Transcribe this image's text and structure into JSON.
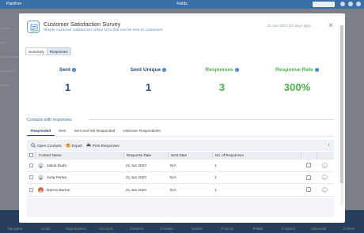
{
  "app": {
    "logo_text": "Pipeliner",
    "title": "Fields",
    "sidebar_items": [
      "Emails",
      "Files",
      "Opportunities",
      "Marketing",
      "Notes"
    ],
    "bottom_nav": [
      {
        "label": "Navigator",
        "active": false
      },
      {
        "label": "Leads",
        "active": false
      },
      {
        "label": "Opportunities",
        "active": false
      },
      {
        "label": "Accounts",
        "active": false
      },
      {
        "label": "Contacts",
        "active": false
      },
      {
        "label": "Activities",
        "active": false
      },
      {
        "label": "Quotes",
        "active": false
      },
      {
        "label": "Projects",
        "active": false
      },
      {
        "label": "Feeds",
        "active": true
      },
      {
        "label": "Analytics",
        "active": false
      },
      {
        "label": "Approvals",
        "active": false
      },
      {
        "label": "Archive",
        "active": false
      }
    ]
  },
  "modal": {
    "title": "Customer Satisfaction Survey",
    "subtitle": "Simple customer satisfaction online form that can be sent to customers.",
    "date": "21 Jun 2023 (24 days ago)",
    "close_glyph": "✕",
    "view_tabs": [
      {
        "label": "Summary",
        "active": false
      },
      {
        "label": "Responses",
        "active": true
      }
    ],
    "stats": [
      {
        "label": "Sent",
        "value": "1",
        "color": "blue"
      },
      {
        "label": "Sent Unique",
        "value": "1",
        "color": "blue"
      },
      {
        "label": "Responses",
        "value": "3",
        "color": "green"
      },
      {
        "label": "Response Rate",
        "value": "300%",
        "color": "green"
      }
    ],
    "section_title": "Contacts with responses",
    "subtabs": [
      {
        "label": "Responded",
        "active": true
      },
      {
        "label": "Sent",
        "active": false
      },
      {
        "label": "Sent And Not Responded",
        "active": false
      },
      {
        "label": "Unknown Respondents",
        "active": false
      }
    ],
    "toolbar": {
      "open_contacts": "Open Contacts",
      "export": "Export",
      "print": "Print Responses",
      "info_glyph": "i"
    },
    "table": {
      "columns": [
        "Contact Name",
        "Response Date",
        "Sent Date",
        "No. of Responses"
      ],
      "rows": [
        {
          "name": "Jakub Ďuďo",
          "response_date": "21 Jun 2023",
          "sent_date": "N/A",
          "responses": "1",
          "avatar": "placeholder"
        },
        {
          "name": "Juraj Perina",
          "response_date": "21 Jun 2023",
          "sent_date": "N/A",
          "responses": "1",
          "avatar": "placeholder"
        },
        {
          "name": "Darren Burton",
          "response_date": "21 Jun 2023",
          "sent_date": "N/A",
          "responses": "1",
          "avatar": "photo"
        }
      ]
    }
  },
  "colors": {
    "accent_blue": "#2c4a78",
    "success_green": "#4cae4c",
    "link_blue": "#3a6ea5",
    "nav_bg": "#274f80"
  }
}
